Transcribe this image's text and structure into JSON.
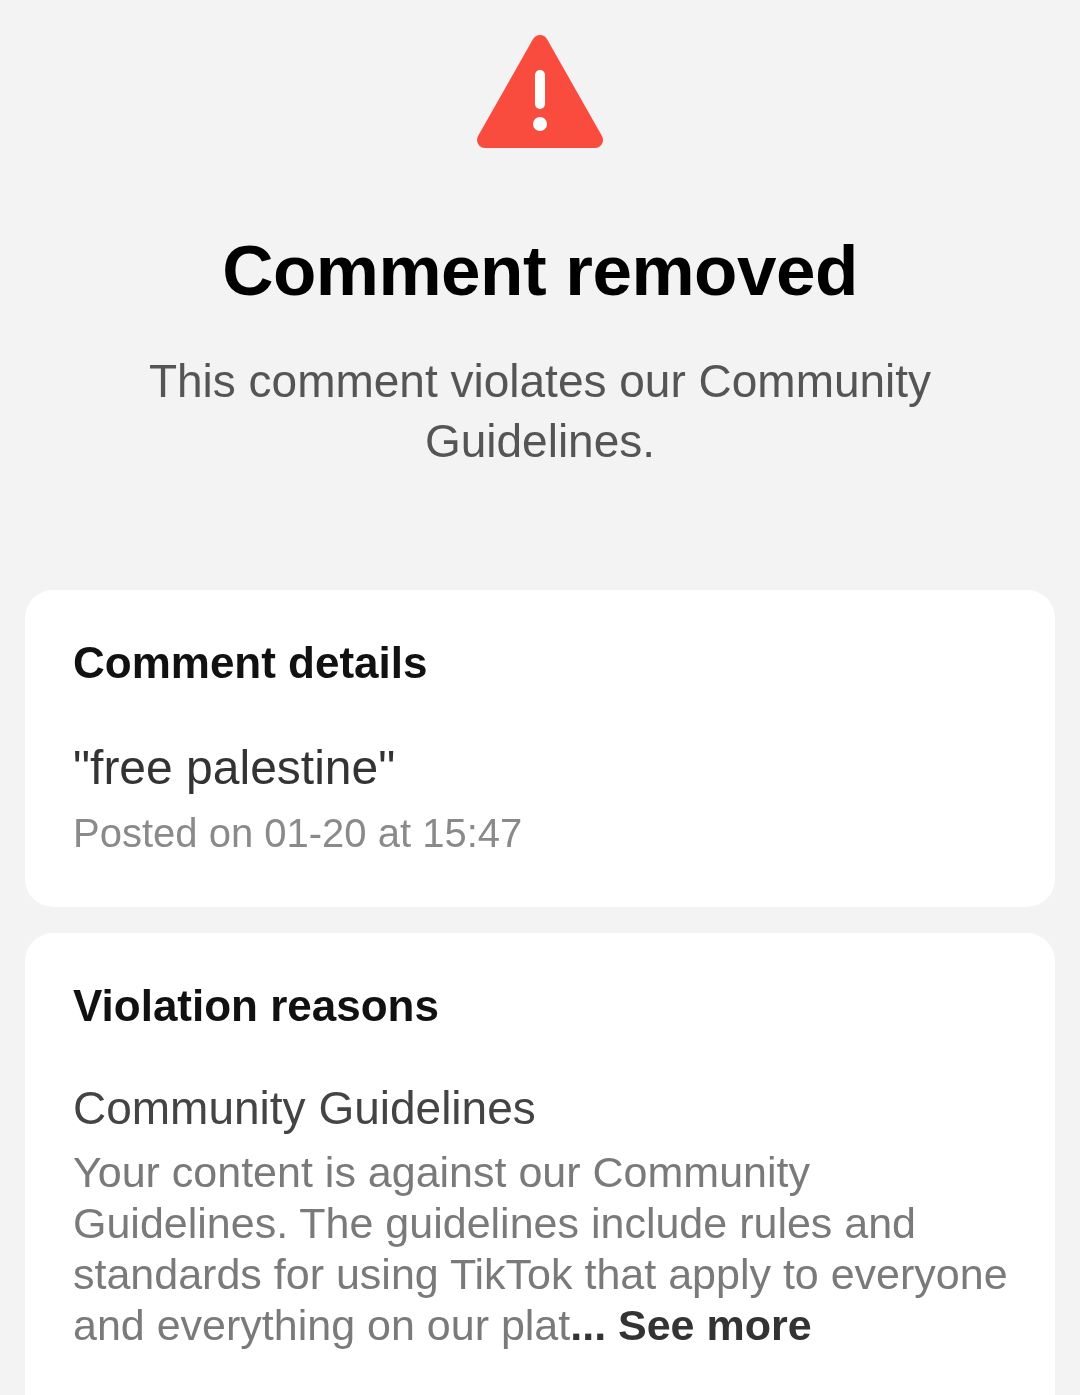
{
  "header": {
    "title": "Comment removed",
    "subtitle": "This comment violates our Community Guidelines."
  },
  "comment_details": {
    "heading": "Comment details",
    "comment": "\"free palestine\"",
    "posted": "Posted on 01-20 at 15:47"
  },
  "violation_reasons": {
    "heading": "Violation reasons",
    "reason_title": "Community Guidelines",
    "description": "Your content is against our Community Guidelines. The guidelines include rules and standards for using TikTok that apply to everyone and everything on our plat",
    "see_more": "... See more"
  }
}
